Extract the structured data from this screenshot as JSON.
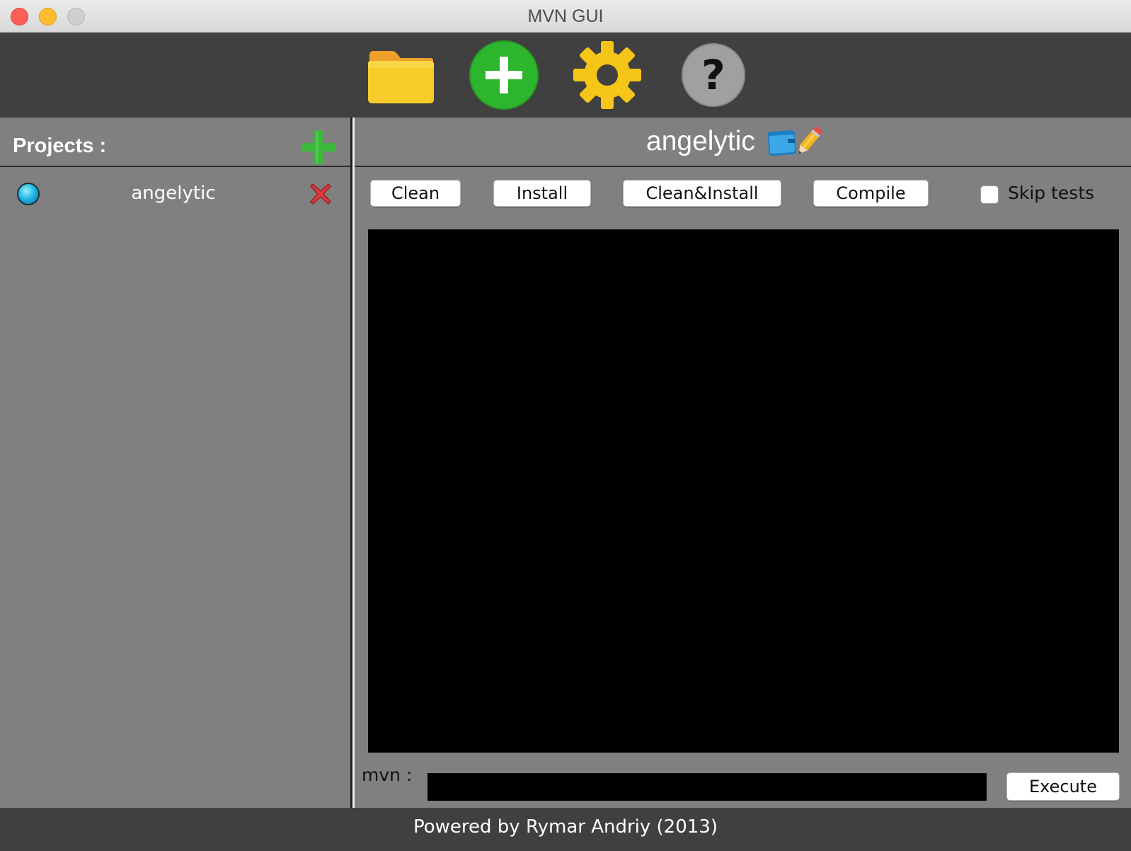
{
  "window": {
    "title": "MVN GUI"
  },
  "toolbar": {
    "items": [
      {
        "name": "open-folder",
        "icon": "folder-icon",
        "color": "#f5c518"
      },
      {
        "name": "new-project",
        "icon": "plus-circle-icon",
        "color": "#2db52d"
      },
      {
        "name": "settings",
        "icon": "gear-icon",
        "color": "#f5c518"
      },
      {
        "name": "help",
        "icon": "question-icon",
        "color": "#9e9e9e"
      }
    ]
  },
  "sidebar": {
    "title": "Projects :",
    "projects": [
      {
        "name": "angelytic",
        "status_icon": "blue-status-dot-icon"
      }
    ]
  },
  "main": {
    "project_title": "angelytic",
    "buttons": {
      "clean": "Clean",
      "install": "Install",
      "clean_install": "Clean&Install",
      "compile": "Compile"
    },
    "skip_tests": {
      "label": "Skip tests",
      "checked": false
    },
    "mvn_label": "mvn :",
    "mvn_value": "",
    "execute": "Execute"
  },
  "status": {
    "text": "Powered by Rymar Andriy (2013)"
  },
  "colors": {
    "toolbar_bg": "#404040",
    "panel_bg": "#808080",
    "console_bg": "#000000",
    "accent_green": "#2db52d"
  }
}
